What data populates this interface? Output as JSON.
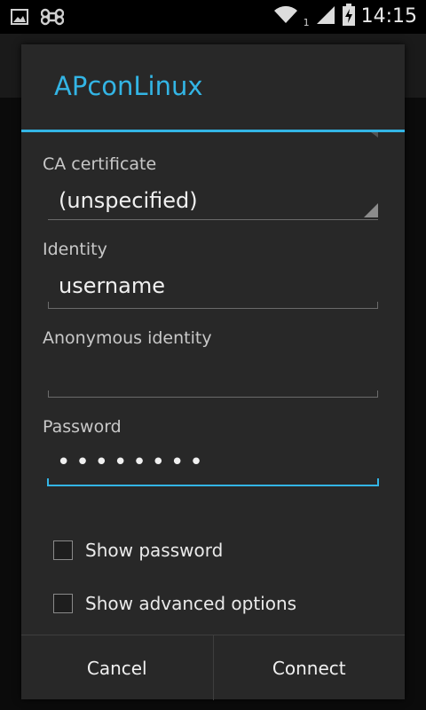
{
  "status_bar": {
    "left_icons": [
      "image-icon",
      "command-icon"
    ],
    "sim_index": "1",
    "time": "14:15"
  },
  "dialog": {
    "title": "APconLinux",
    "fields": {
      "ca_certificate": {
        "label": "CA certificate",
        "value": "(unspecified)"
      },
      "identity": {
        "label": "Identity",
        "value": "username"
      },
      "anonymous_identity": {
        "label": "Anonymous identity",
        "value": ""
      },
      "password": {
        "label": "Password",
        "value": "••••••••"
      }
    },
    "checkboxes": [
      {
        "label": "Show password",
        "checked": false
      },
      {
        "label": "Show advanced options",
        "checked": false
      }
    ],
    "buttons": {
      "cancel": "Cancel",
      "connect": "Connect"
    }
  },
  "colors": {
    "accent": "#33b5e5",
    "dialog_bg": "#282828"
  }
}
